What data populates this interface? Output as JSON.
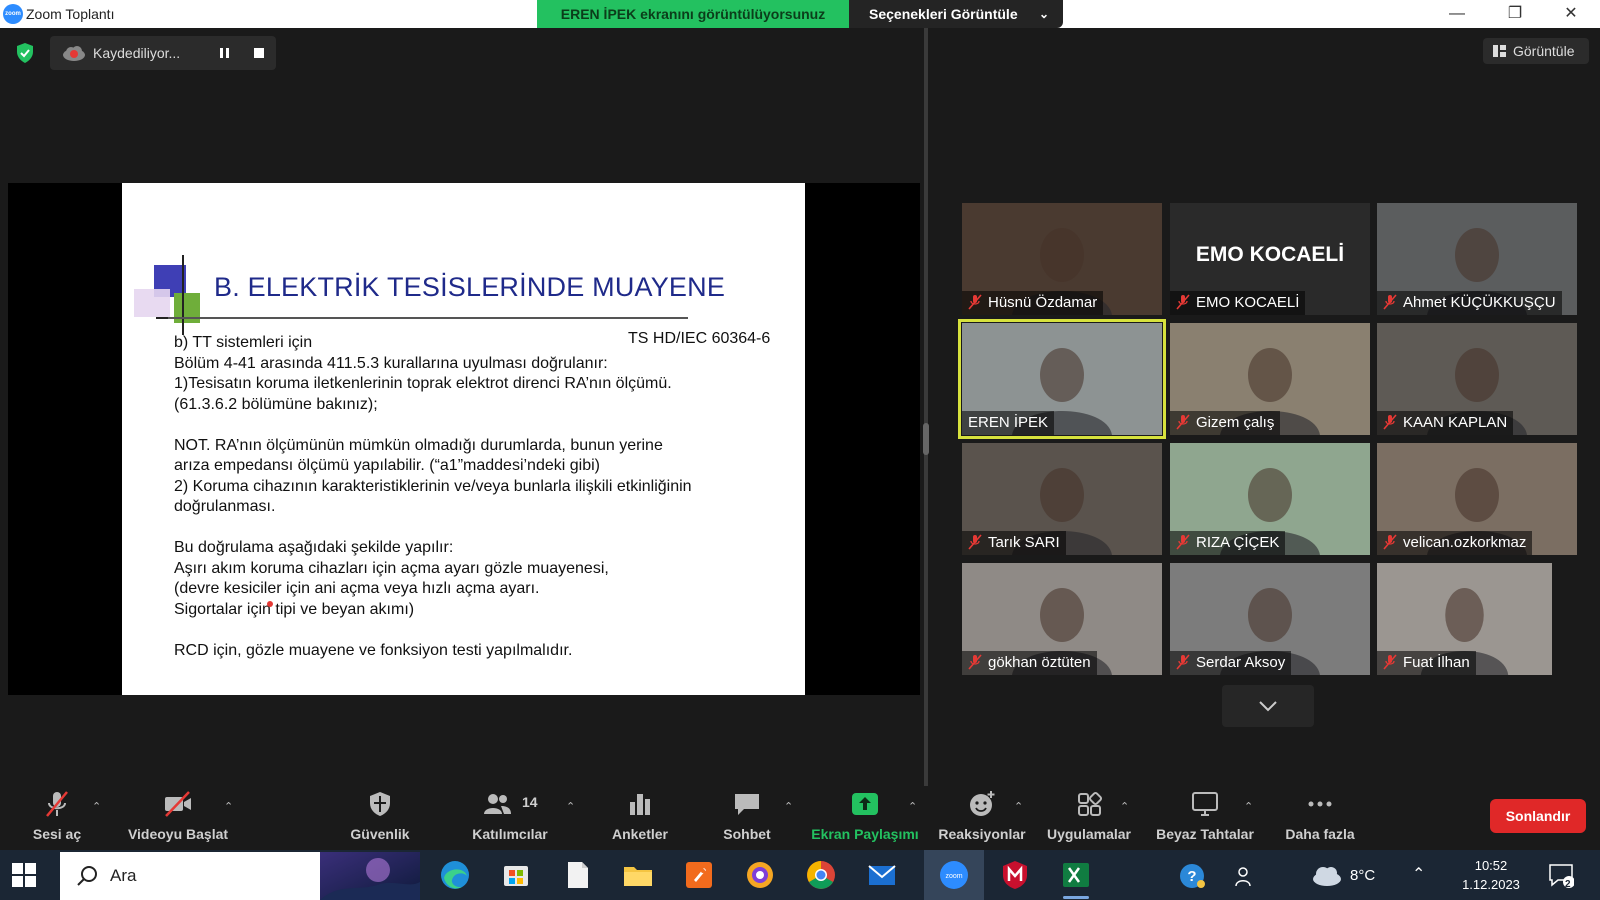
{
  "window": {
    "title": "Zoom Toplantı",
    "share_banner": "EREN İPEK ekranını görüntülüyorsunuz",
    "view_options": "Seçenekleri Görüntüle",
    "controls": [
      "minimize",
      "restore",
      "close"
    ]
  },
  "recording": {
    "status": "Kaydediliyor..."
  },
  "view_button": "Görüntüle",
  "slide": {
    "title": "B. ELEKTRİK TESİSLERİNDE MUAYENE",
    "standard": "TS HD/IEC 60364-6",
    "lines": [
      "b) TT sistemleri için",
      "Bölüm 4-41 arasında 411.5.3 kurallarına uyulması doğrulanır:",
      "1)Tesisatın koruma iletkenlerinin toprak elektrot direnci RA’nın ölçümü.",
      "(61.3.6.2 bölümüne bakınız);",
      "",
      "NOT. RA’nın ölçümünün mümkün olmadığı durumlarda, bunun yerine",
      "arıza empedansı ölçümü yapılabilir. (“a1”maddesi’ndeki gibi)",
      "2) Koruma cihazının karakteristiklerinin ve/veya bunlarla ilişkili etkinliğinin",
      "doğrulanması.",
      "",
      "Bu doğrulama aşağıdaki şekilde yapılır:",
      "Aşırı akım koruma cihazları için açma ayarı gözle muayenesi,",
      "(devre kesiciler için ani açma veya hızlı açma ayarı.",
      "Sigortalar için tipi ve beyan akımı)",
      "",
      "RCD için, gözle muayene ve fonksiyon testi yapılmalıdır."
    ]
  },
  "participants": [
    {
      "name": "Hüsnü Özdamar",
      "muted": true,
      "bg": "#4a3a30"
    },
    {
      "name": "EMO KOCAELİ",
      "muted": true,
      "bg": "#2a2a2a",
      "label": "EMO KOCAELİ"
    },
    {
      "name": "Ahmet KÜÇÜKKUŞÇU",
      "muted": true,
      "bg": "#5b5d5e"
    },
    {
      "name": "EREN İPEK",
      "muted": false,
      "bg": "#8d9393",
      "active": true
    },
    {
      "name": "Gizem çalış",
      "muted": true,
      "bg": "#8a8070"
    },
    {
      "name": "KAAN KAPLAN",
      "muted": true,
      "bg": "#5e5a55"
    },
    {
      "name": "Tarık SARI",
      "muted": true,
      "bg": "#5a534d"
    },
    {
      "name": "RIZA ÇİÇEK",
      "muted": true,
      "bg": "#8fa68f"
    },
    {
      "name": "velican.ozkorkmaz",
      "muted": true,
      "bg": "#7b6e62"
    },
    {
      "name": "gökhan öztüten",
      "muted": true,
      "bg": "#8f8a86"
    },
    {
      "name": "Serdar Aksoy",
      "muted": true,
      "bg": "#7c7c7c"
    },
    {
      "name": "Fuat İlhan",
      "muted": true,
      "bg": "#9b9691"
    }
  ],
  "toolbar": {
    "unmute": "Sesi aç",
    "start_video": "Videoyu Başlat",
    "security": "Güvenlik",
    "participants": "Katılımcılar",
    "participants_count": "14",
    "polls": "Anketler",
    "chat": "Sohbet",
    "share_screen": "Ekran Paylaşımı",
    "reactions": "Reaksiyonlar",
    "apps": "Uygulamalar",
    "whiteboards": "Beyaz Tahtalar",
    "more": "Daha fazla",
    "end": "Sonlandır"
  },
  "taskbar": {
    "search_placeholder": "Ara",
    "temperature": "8°C",
    "time": "10:52",
    "date": "1.12.2023",
    "notifications": "2"
  },
  "colors": {
    "zoom_green": "#23c160",
    "end_red": "#e02828",
    "active_speaker": "#d7e23d",
    "slide_title": "#1f2a8a"
  }
}
